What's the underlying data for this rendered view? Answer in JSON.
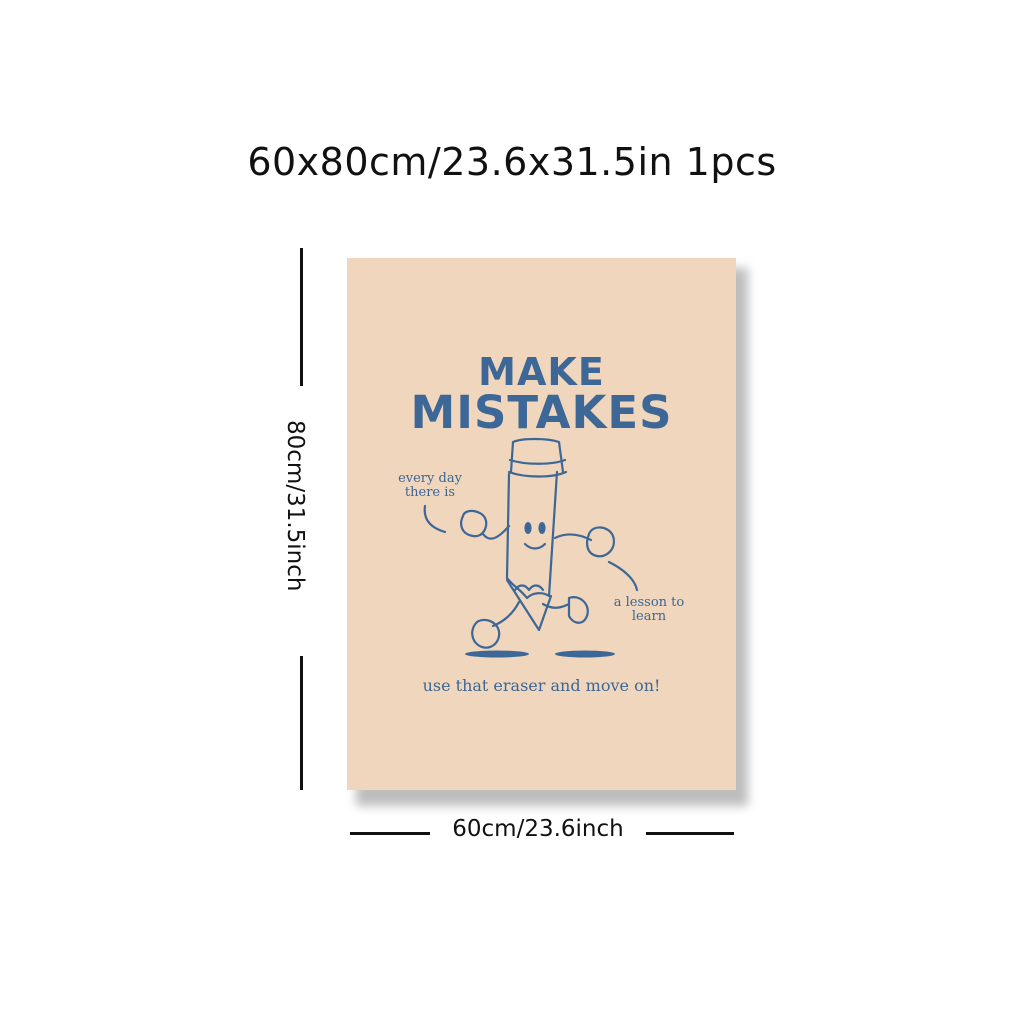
{
  "header": {
    "size_text": "60x80cm/23.6x31.5in 1pcs"
  },
  "dimensions": {
    "height_label": "80cm/31.5inch",
    "width_label": "60cm/23.6inch"
  },
  "poster": {
    "headline_line1": "MAKE",
    "headline_line2": "MISTAKES",
    "note_left": "every day there is",
    "note_right": "a lesson to learn",
    "footer": "use that eraser and move on!",
    "colors": {
      "background": "#efd6bd",
      "ink": "#3c6796"
    },
    "illustration": "walking-pencil-character"
  }
}
